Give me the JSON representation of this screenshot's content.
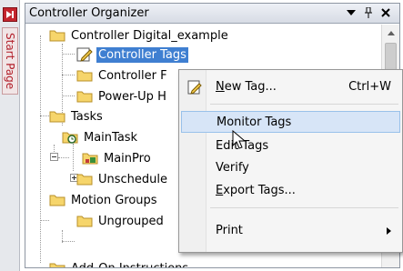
{
  "side_tab": {
    "label": "Start Page"
  },
  "panel": {
    "title": "Controller Organizer"
  },
  "tree": {
    "controller": "Controller Digital_example",
    "controller_tags": "Controller Tags",
    "controller_faults": "Controller F",
    "power_up": "Power-Up H",
    "tasks": "Tasks",
    "main_task": "MainTask",
    "main_program": "MainPro",
    "unscheduled": "Unschedule",
    "motion_groups": "Motion Groups",
    "ungrouped": "Ungrouped",
    "add_on": "Add-On Instructions"
  },
  "context_menu": {
    "new_tag": {
      "prefix": "",
      "mnemonic": "N",
      "rest": "ew Tag...",
      "shortcut": "Ctrl+W"
    },
    "monitor_tags": "Monitor Tags",
    "edit_tags": "Edit Tags",
    "verify": "Verify",
    "export_tags": {
      "prefix": "",
      "mnemonic": "E",
      "rest": "xport Tags..."
    },
    "print": "Print"
  },
  "colors": {
    "selection": "#3f7fd1",
    "menu_highlight": "#d7e5f7",
    "side_accent": "#c4262e"
  },
  "icons": {
    "side": "go-arrow-icon",
    "header": [
      "dropdown-arrow-icon",
      "pin-icon",
      "close-icon"
    ],
    "tree": [
      "folder-icon",
      "tags-icon",
      "task-icon",
      "program-icon"
    ],
    "menu": [
      "new-tag-icon",
      "submenu-arrow-icon"
    ]
  }
}
